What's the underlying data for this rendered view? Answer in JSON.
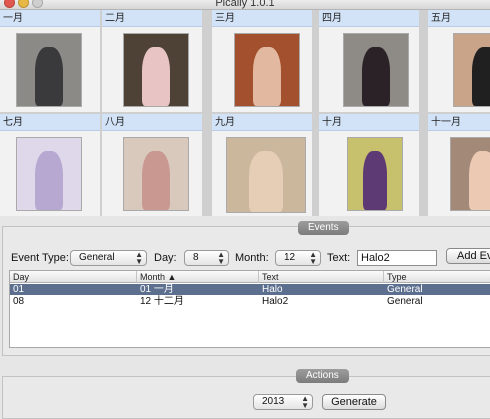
{
  "window": {
    "title": "Pically 1.0.1"
  },
  "months": [
    {
      "label": "一月",
      "photo": {
        "bg": "#8c8a86",
        "figure": "#3a3a3c"
      }
    },
    {
      "label": "二月",
      "photo": {
        "bg": "#4d4235",
        "figure": "#e8c4c4"
      }
    },
    {
      "label": "三月",
      "photo": {
        "bg": "#a2502e",
        "figure": "#e2b8a0"
      }
    },
    {
      "label": "四月",
      "photo": {
        "bg": "#8e8a86",
        "figure": "#2a2226"
      }
    },
    {
      "label": "五月",
      "photo": {
        "bg": "#c9a489",
        "figure": "#202020"
      }
    },
    {
      "label": "七月",
      "photo": {
        "bg": "#dfd8ea",
        "figure": "#b6a8d0"
      }
    },
    {
      "label": "八月",
      "photo": {
        "bg": "#d9c9bd",
        "figure": "#c99890"
      }
    },
    {
      "label": "九月",
      "photo": {
        "bg": "#cbb89c",
        "figure": "#e6cdb6"
      }
    },
    {
      "label": "十月",
      "photo": {
        "bg": "#c7c16e",
        "figure": "#5d3a74"
      }
    },
    {
      "label": "十一月",
      "photo": {
        "bg": "#a38a78",
        "figure": "#ecc9b3"
      }
    }
  ],
  "events": {
    "section_label": "Events",
    "event_type_label": "Event Type:",
    "event_type_value": "General",
    "day_label": "Day:",
    "day_value": "8",
    "month_label": "Month:",
    "month_value": "12",
    "text_label": "Text:",
    "text_value": "Halo2",
    "add_button": "Add Ev",
    "table": {
      "columns": [
        "Day",
        "Month ▲",
        "Text",
        "Type"
      ],
      "rows": [
        {
          "day": "01",
          "month": "01 一月",
          "text": "Halo",
          "type": "General",
          "selected": true
        },
        {
          "day": "08",
          "month": "12 十二月",
          "text": "Halo2",
          "type": "General",
          "selected": false
        }
      ]
    }
  },
  "actions": {
    "section_label": "Actions",
    "year_value": "2013",
    "generate_button": "Generate"
  }
}
